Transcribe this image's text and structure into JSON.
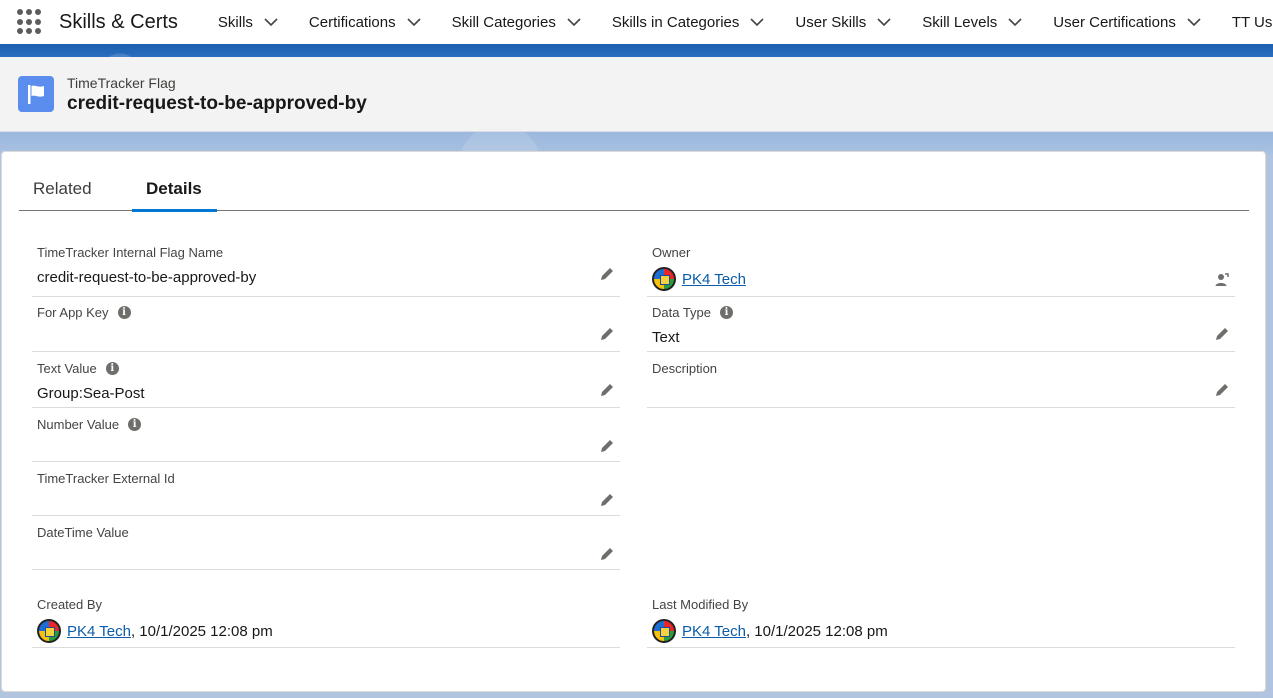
{
  "app": {
    "name": "Skills & Certs",
    "nav_items": [
      {
        "label": "Skills"
      },
      {
        "label": "Certifications"
      },
      {
        "label": "Skill Categories"
      },
      {
        "label": "Skills in Categories"
      },
      {
        "label": "User Skills"
      },
      {
        "label": "Skill Levels"
      },
      {
        "label": "User Certifications"
      },
      {
        "label": "TT Users In"
      }
    ]
  },
  "record": {
    "object_type": "TimeTracker Flag",
    "title": "credit-request-to-be-approved-by",
    "icon": "flag-icon",
    "icon_color": "#5a8ded"
  },
  "tabs": {
    "related": "Related",
    "details": "Details",
    "active": "Details"
  },
  "fields": {
    "internal_flag_name": {
      "label": "TimeTracker Internal Flag Name",
      "value": "credit-request-to-be-approved-by"
    },
    "for_app_key": {
      "label": "For App Key",
      "value": ""
    },
    "text_value": {
      "label": "Text Value",
      "value": "Group:Sea-Post"
    },
    "number_value": {
      "label": "Number Value",
      "value": ""
    },
    "external_id": {
      "label": "TimeTracker External Id",
      "value": ""
    },
    "datetime_value": {
      "label": "DateTime Value",
      "value": ""
    },
    "owner": {
      "label": "Owner",
      "value": "PK4 Tech"
    },
    "data_type": {
      "label": "Data Type",
      "value": "Text"
    },
    "description": {
      "label": "Description",
      "value": ""
    },
    "created_by": {
      "label": "Created By",
      "user": "PK4 Tech",
      "date": ", 10/1/2025 12:08 pm"
    },
    "last_modified_by": {
      "label": "Last Modified By",
      "user": "PK4 Tech",
      "date": ", 10/1/2025 12:08 pm"
    }
  },
  "colors": {
    "accent": "#0176d3",
    "link": "#0b5cab",
    "band": "#1b5fae"
  }
}
